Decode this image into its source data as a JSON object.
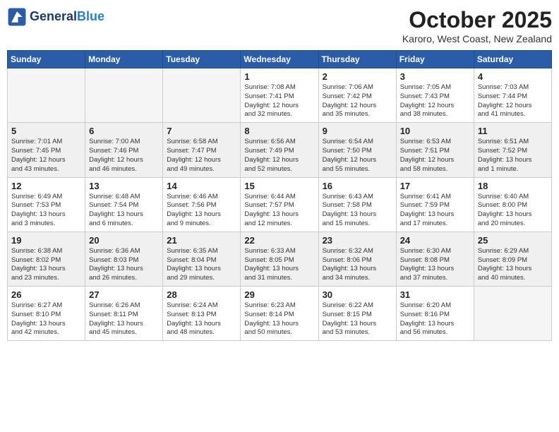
{
  "header": {
    "logo_line1": "General",
    "logo_line2": "Blue",
    "month": "October 2025",
    "location": "Karoro, West Coast, New Zealand"
  },
  "days_of_week": [
    "Sunday",
    "Monday",
    "Tuesday",
    "Wednesday",
    "Thursday",
    "Friday",
    "Saturday"
  ],
  "weeks": [
    [
      {
        "day": "",
        "info": ""
      },
      {
        "day": "",
        "info": ""
      },
      {
        "day": "",
        "info": ""
      },
      {
        "day": "1",
        "info": "Sunrise: 7:08 AM\nSunset: 7:41 PM\nDaylight: 12 hours\nand 32 minutes."
      },
      {
        "day": "2",
        "info": "Sunrise: 7:06 AM\nSunset: 7:42 PM\nDaylight: 12 hours\nand 35 minutes."
      },
      {
        "day": "3",
        "info": "Sunrise: 7:05 AM\nSunset: 7:43 PM\nDaylight: 12 hours\nand 38 minutes."
      },
      {
        "day": "4",
        "info": "Sunrise: 7:03 AM\nSunset: 7:44 PM\nDaylight: 12 hours\nand 41 minutes."
      }
    ],
    [
      {
        "day": "5",
        "info": "Sunrise: 7:01 AM\nSunset: 7:45 PM\nDaylight: 12 hours\nand 43 minutes."
      },
      {
        "day": "6",
        "info": "Sunrise: 7:00 AM\nSunset: 7:46 PM\nDaylight: 12 hours\nand 46 minutes."
      },
      {
        "day": "7",
        "info": "Sunrise: 6:58 AM\nSunset: 7:47 PM\nDaylight: 12 hours\nand 49 minutes."
      },
      {
        "day": "8",
        "info": "Sunrise: 6:56 AM\nSunset: 7:49 PM\nDaylight: 12 hours\nand 52 minutes."
      },
      {
        "day": "9",
        "info": "Sunrise: 6:54 AM\nSunset: 7:50 PM\nDaylight: 12 hours\nand 55 minutes."
      },
      {
        "day": "10",
        "info": "Sunrise: 6:53 AM\nSunset: 7:51 PM\nDaylight: 12 hours\nand 58 minutes."
      },
      {
        "day": "11",
        "info": "Sunrise: 6:51 AM\nSunset: 7:52 PM\nDaylight: 13 hours\nand 1 minute."
      }
    ],
    [
      {
        "day": "12",
        "info": "Sunrise: 6:49 AM\nSunset: 7:53 PM\nDaylight: 13 hours\nand 3 minutes."
      },
      {
        "day": "13",
        "info": "Sunrise: 6:48 AM\nSunset: 7:54 PM\nDaylight: 13 hours\nand 6 minutes."
      },
      {
        "day": "14",
        "info": "Sunrise: 6:46 AM\nSunset: 7:56 PM\nDaylight: 13 hours\nand 9 minutes."
      },
      {
        "day": "15",
        "info": "Sunrise: 6:44 AM\nSunset: 7:57 PM\nDaylight: 13 hours\nand 12 minutes."
      },
      {
        "day": "16",
        "info": "Sunrise: 6:43 AM\nSunset: 7:58 PM\nDaylight: 13 hours\nand 15 minutes."
      },
      {
        "day": "17",
        "info": "Sunrise: 6:41 AM\nSunset: 7:59 PM\nDaylight: 13 hours\nand 17 minutes."
      },
      {
        "day": "18",
        "info": "Sunrise: 6:40 AM\nSunset: 8:00 PM\nDaylight: 13 hours\nand 20 minutes."
      }
    ],
    [
      {
        "day": "19",
        "info": "Sunrise: 6:38 AM\nSunset: 8:02 PM\nDaylight: 13 hours\nand 23 minutes."
      },
      {
        "day": "20",
        "info": "Sunrise: 6:36 AM\nSunset: 8:03 PM\nDaylight: 13 hours\nand 26 minutes."
      },
      {
        "day": "21",
        "info": "Sunrise: 6:35 AM\nSunset: 8:04 PM\nDaylight: 13 hours\nand 29 minutes."
      },
      {
        "day": "22",
        "info": "Sunrise: 6:33 AM\nSunset: 8:05 PM\nDaylight: 13 hours\nand 31 minutes."
      },
      {
        "day": "23",
        "info": "Sunrise: 6:32 AM\nSunset: 8:06 PM\nDaylight: 13 hours\nand 34 minutes."
      },
      {
        "day": "24",
        "info": "Sunrise: 6:30 AM\nSunset: 8:08 PM\nDaylight: 13 hours\nand 37 minutes."
      },
      {
        "day": "25",
        "info": "Sunrise: 6:29 AM\nSunset: 8:09 PM\nDaylight: 13 hours\nand 40 minutes."
      }
    ],
    [
      {
        "day": "26",
        "info": "Sunrise: 6:27 AM\nSunset: 8:10 PM\nDaylight: 13 hours\nand 42 minutes."
      },
      {
        "day": "27",
        "info": "Sunrise: 6:26 AM\nSunset: 8:11 PM\nDaylight: 13 hours\nand 45 minutes."
      },
      {
        "day": "28",
        "info": "Sunrise: 6:24 AM\nSunset: 8:13 PM\nDaylight: 13 hours\nand 48 minutes."
      },
      {
        "day": "29",
        "info": "Sunrise: 6:23 AM\nSunset: 8:14 PM\nDaylight: 13 hours\nand 50 minutes."
      },
      {
        "day": "30",
        "info": "Sunrise: 6:22 AM\nSunset: 8:15 PM\nDaylight: 13 hours\nand 53 minutes."
      },
      {
        "day": "31",
        "info": "Sunrise: 6:20 AM\nSunset: 8:16 PM\nDaylight: 13 hours\nand 56 minutes."
      },
      {
        "day": "",
        "info": ""
      }
    ]
  ]
}
